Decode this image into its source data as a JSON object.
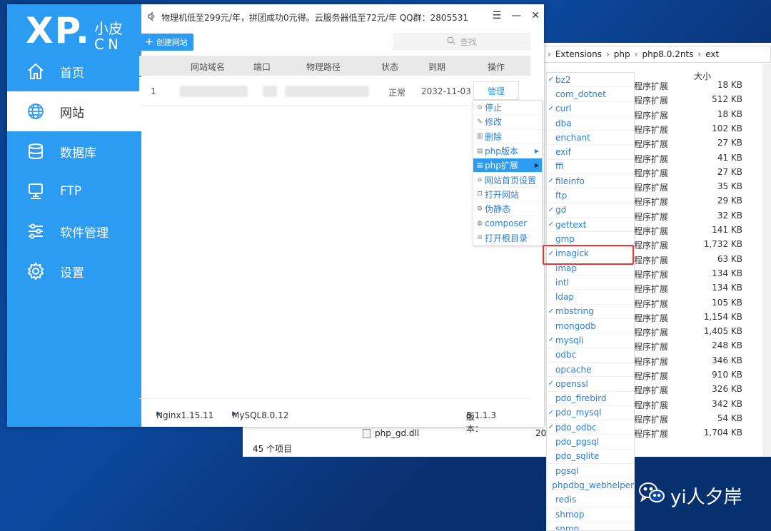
{
  "explorer": {
    "breadcrumb": [
      "Extensions",
      "php",
      "php8.0.2nts",
      "ext"
    ],
    "col_size": "大小",
    "files": [
      {
        "type": "程序扩展",
        "size": "18 KB"
      },
      {
        "type": "程序扩展",
        "size": "512 KB"
      },
      {
        "type": "程序扩展",
        "size": "18 KB"
      },
      {
        "type": "程序扩展",
        "size": "102 KB"
      },
      {
        "type": "程序扩展",
        "size": "27 KB"
      },
      {
        "type": "程序扩展",
        "size": "41 KB"
      },
      {
        "type": "程序扩展",
        "size": "27 KB"
      },
      {
        "type": "程序扩展",
        "size": "35 KB"
      },
      {
        "type": "程序扩展",
        "size": "29 KB"
      },
      {
        "type": "程序扩展",
        "size": "32 KB"
      },
      {
        "type": "程序扩展",
        "size": "141 KB"
      },
      {
        "type": "程序扩展",
        "size": "1,732 KB"
      },
      {
        "type": "程序扩展",
        "size": "63 KB"
      },
      {
        "type": "程序扩展",
        "size": "134 KB"
      },
      {
        "type": "程序扩展",
        "size": "134 KB"
      },
      {
        "type": "程序扩展",
        "size": "105 KB"
      },
      {
        "type": "程序扩展",
        "size": "1,154 KB"
      },
      {
        "type": "程序扩展",
        "size": "1,405 KB"
      },
      {
        "type": "程序扩展",
        "size": "248 KB"
      },
      {
        "type": "程序扩展",
        "size": "346 KB"
      },
      {
        "type": "程序扩展",
        "size": "910 KB"
      },
      {
        "type": "程序扩展",
        "size": "326 KB"
      },
      {
        "type": "程序扩展",
        "size": "342 KB"
      },
      {
        "type": "程序扩展",
        "size": "54 KB"
      },
      {
        "type": "程序扩展",
        "size": "1,704 KB"
      }
    ],
    "last_file_name": "php_gd.dll",
    "last_file_date": "20",
    "item_count": "45 个项目"
  },
  "app": {
    "logo_main": "XP.",
    "logo_sub1": "小皮",
    "logo_sub2": "CN",
    "nav": [
      {
        "label": "首页",
        "icon": "home-icon"
      },
      {
        "label": "网站",
        "icon": "globe-icon"
      },
      {
        "label": "数据库",
        "icon": "database-icon"
      },
      {
        "label": "FTP",
        "icon": "server-icon"
      },
      {
        "label": "软件管理",
        "icon": "sliders-icon"
      },
      {
        "label": "设置",
        "icon": "gear-icon"
      }
    ],
    "active_nav": "网站",
    "announcement": "物理机低至299元/年，拼团成功0元得。云服务器低至72元/年  QQ群：2805531",
    "create_site_label": "创建网站",
    "search_placeholder": "查找",
    "table_headers": [
      "网站域名",
      "端口",
      "物理路径",
      "状态",
      "到期",
      "操作"
    ],
    "row": {
      "index": "1",
      "status": "正常",
      "expiry": "2032-11-03",
      "action": "管理"
    },
    "status": {
      "nginx": "Nginx1.15.11",
      "mysql": "MySQL8.0.12",
      "version_label": "版本：",
      "version": "8.1.1.3"
    }
  },
  "context_menu": [
    {
      "label": "停止",
      "icon": "stop-icon",
      "active": false,
      "submenu": false
    },
    {
      "label": "修改",
      "icon": "edit-icon",
      "active": false,
      "submenu": false
    },
    {
      "label": "删除",
      "icon": "trash-icon",
      "active": false,
      "submenu": false
    },
    {
      "label": "php版本",
      "icon": "file-icon",
      "active": false,
      "submenu": true
    },
    {
      "label": "php扩展",
      "icon": "file-icon",
      "active": true,
      "submenu": true
    },
    {
      "label": "网站首页设置",
      "icon": "home-icon",
      "active": false,
      "submenu": false
    },
    {
      "label": "打开网站",
      "icon": "open-icon",
      "active": false,
      "submenu": false
    },
    {
      "label": "伪静态",
      "icon": "settings-icon",
      "active": false,
      "submenu": false
    },
    {
      "label": "composer",
      "icon": "package-icon",
      "active": false,
      "submenu": false
    },
    {
      "label": "打开根目录",
      "icon": "list-icon",
      "active": false,
      "submenu": false
    }
  ],
  "extensions": [
    {
      "name": "bz2",
      "checked": true
    },
    {
      "name": "com_dotnet",
      "checked": false
    },
    {
      "name": "curl",
      "checked": true
    },
    {
      "name": "dba",
      "checked": false
    },
    {
      "name": "enchant",
      "checked": false
    },
    {
      "name": "exif",
      "checked": false
    },
    {
      "name": "ffi",
      "checked": false
    },
    {
      "name": "fileinfo",
      "checked": true
    },
    {
      "name": "ftp",
      "checked": false
    },
    {
      "name": "gd",
      "checked": true
    },
    {
      "name": "gettext",
      "checked": true
    },
    {
      "name": "gmp",
      "checked": false
    },
    {
      "name": "imagick",
      "checked": true
    },
    {
      "name": "imap",
      "checked": false
    },
    {
      "name": "intl",
      "checked": false
    },
    {
      "name": "ldap",
      "checked": false
    },
    {
      "name": "mbstring",
      "checked": true
    },
    {
      "name": "mongodb",
      "checked": false
    },
    {
      "name": "mysqli",
      "checked": true
    },
    {
      "name": "odbc",
      "checked": false
    },
    {
      "name": "opcache",
      "checked": false
    },
    {
      "name": "openssl",
      "checked": true
    },
    {
      "name": "pdo_firebird",
      "checked": false
    },
    {
      "name": "pdo_mysql",
      "checked": true
    },
    {
      "name": "pdo_odbc",
      "checked": true
    },
    {
      "name": "pdo_pgsql",
      "checked": false
    },
    {
      "name": "pdo_sqlite",
      "checked": false
    },
    {
      "name": "pgsql",
      "checked": false
    },
    {
      "name": "phpdbg_webhelper",
      "checked": false
    },
    {
      "name": "redis",
      "checked": false
    },
    {
      "name": "shmop",
      "checked": false
    },
    {
      "name": "snmp",
      "checked": false
    }
  ],
  "watermark": "yi人夕岸",
  "colors": {
    "accent": "#2b9cf2",
    "highlight": "#e53935",
    "link": "#2b7fd6"
  }
}
